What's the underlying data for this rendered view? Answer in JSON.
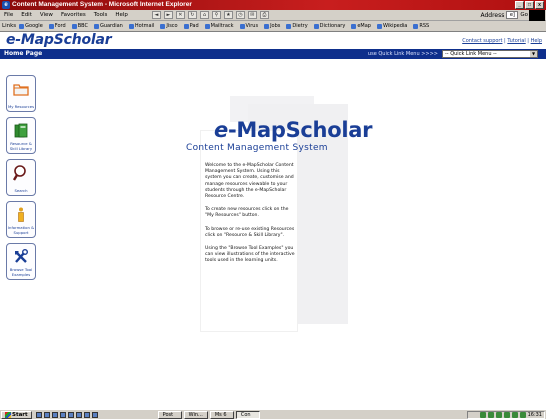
{
  "window": {
    "title": "Content Management System - Microsoft Internet Explorer",
    "buttons": [
      "_",
      "□",
      "x"
    ]
  },
  "menubar": {
    "items": [
      "File",
      "Edit",
      "View",
      "Favorites",
      "Tools",
      "Help"
    ],
    "address_label": "Address",
    "address_value": "e]",
    "go_label": "Go"
  },
  "linksbar": {
    "label": "Links",
    "links": [
      "Google",
      "Ford",
      "BBC",
      "Guardian",
      "Hotmail",
      "Jisco",
      "Pad",
      "Mailtrack",
      "Virus",
      "Jobs",
      "Dietry",
      "Dictionary",
      "eMap",
      "Wikipedia",
      "RSS"
    ]
  },
  "header": {
    "logo_prefix": "e",
    "logo_rest": "-MapScholar",
    "links": [
      "Contact support",
      "Tutorial",
      "Help"
    ]
  },
  "navbar": {
    "crumb": "Home Page",
    "quick_label": "use Quick Link Menu >>>>",
    "quick_select": "-- Quick Link Menu --"
  },
  "sidebar": {
    "items": [
      {
        "label": "My Resources",
        "icon": "folder-icon"
      },
      {
        "label": "Resource & Skill Library",
        "icon": "books-icon"
      },
      {
        "label": "Search",
        "icon": "magnifier-icon"
      },
      {
        "label": "Information & Support",
        "icon": "info-icon"
      },
      {
        "label": "Browse Tool Examples",
        "icon": "tools-icon"
      }
    ]
  },
  "main": {
    "title_e": "e",
    "title_rest": "-MapScholar",
    "subtitle": "Content Management System",
    "paragraphs": [
      "Welcome to the e-MapScholar Content Management System. Using this system you can create, customise and manage resources viewable to your students through the e-MapScholar Resource Centre.",
      "To create new resources click on the \"My Resources\" button.",
      "To browse or re-use existing Resources click on \"Resource & Skill Library\".",
      "Using the \"Browse Tool Examples\" you can view illustrations of the interactive tools used in the learning units."
    ]
  },
  "taskbar": {
    "start_label": "Start",
    "tasks": [
      "Post",
      "Win...",
      "Ms 6",
      "Con"
    ],
    "active_task_index": 3,
    "clock": "16:31"
  },
  "colors": {
    "brand_blue": "#1a3e96",
    "nav_navy": "#0e2f8c",
    "titlebar_red": "#c81e1e",
    "chrome_gray": "#d4d0c8"
  }
}
